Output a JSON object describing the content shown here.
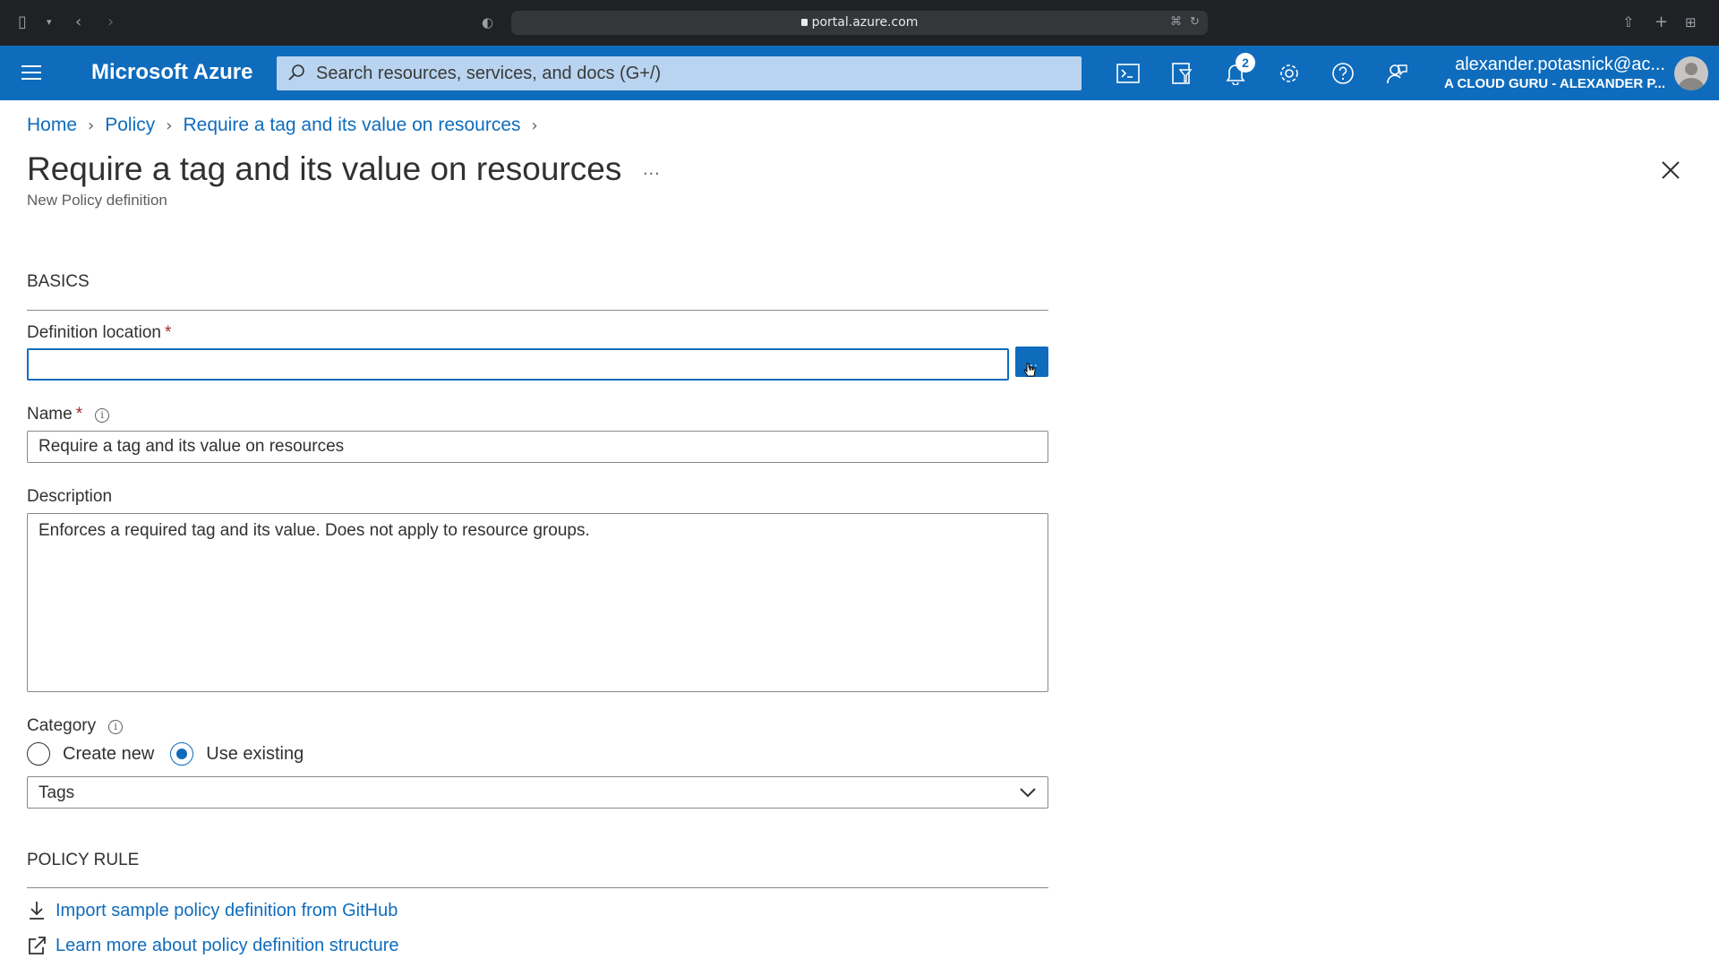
{
  "browser": {
    "url": "portal.azure.com"
  },
  "header": {
    "brand": "Microsoft Azure",
    "search_placeholder": "Search resources, services, and docs (G+/)",
    "notification_count": "2",
    "account_email": "alexander.potasnick@ac...",
    "account_directory": "A CLOUD GURU - ALEXANDER P...",
    "accent_color": "#0f6cbd",
    "icons": [
      "menu-icon",
      "cloud-shell-icon",
      "directory-filter-icon",
      "bell-icon",
      "gear-icon",
      "help-icon",
      "feedback-icon"
    ]
  },
  "breadcrumb": {
    "items": [
      "Home",
      "Policy",
      "Require a tag and its value on resources"
    ]
  },
  "page": {
    "title": "Require a tag and its value on resources",
    "more": "...",
    "subtitle": "New Policy definition"
  },
  "form": {
    "basics_title": "BASICS",
    "definition_location": {
      "label": "Definition location",
      "required_mark": "*",
      "value": "",
      "browse_label": "..."
    },
    "name": {
      "label": "Name",
      "required_mark": "*",
      "value": "Require a tag and its value on resources"
    },
    "description": {
      "label": "Description",
      "value": "Enforces a required tag and its value. Does not apply to resource groups."
    },
    "category": {
      "label": "Category",
      "options": [
        "Create new",
        "Use existing"
      ],
      "selected_option": "Use existing",
      "selected_value": "Tags"
    },
    "policy_rule_title": "POLICY RULE",
    "links": {
      "import": "Import sample policy definition from GitHub",
      "learn_more": "Learn more about policy definition structure"
    }
  }
}
